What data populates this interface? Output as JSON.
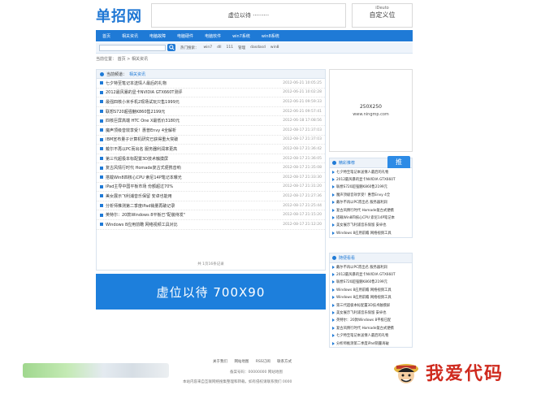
{
  "header": {
    "logo": "单招网",
    "banner_text": "虚位以待 ·········",
    "ad_small": "iDeuto",
    "ad_big": "自定义位"
  },
  "nav": [
    "首页",
    "相关资讯",
    "电脑故障",
    "电脑硬件",
    "电脑软件",
    "win7系统",
    "win8系统"
  ],
  "search": {
    "hot_label": "热门搜索：",
    "hot_words": [
      "win7",
      "dll",
      "111",
      "管理",
      "dasdasd",
      "win8"
    ]
  },
  "breadcrumb": "当前位置： 首页 > 相关资讯",
  "list": {
    "head_title": "当前频道：",
    "head_current": "相关资讯",
    "rows": [
      {
        "title": "七夕特至笔记本送情人最后的礼物",
        "date": "2012-06-21 10:05:25"
      },
      {
        "title": "2012最风暴的显卡NVIDIA GTX660T测评",
        "date": "2012-06-21 10:02:28"
      },
      {
        "title": "最强四核小米手机2现场试玩只售1999元",
        "date": "2012-06-21 09:59:33"
      },
      {
        "title": "联想S720超强魅K860售2199元",
        "date": "2012-06-21 09:57:41"
      },
      {
        "title": "四核巨屏高端 HTC One X最低价3180元",
        "date": "2012-06-18 17:08:56"
      },
      {
        "title": "魔声顶级音效享受！惠普Envy 4全解析",
        "date": "2012-08-17 21:37:03"
      },
      {
        "title": "IBM宣布量子计算机研究已获得重大突破",
        "date": "2012-08-17 21:37:03"
      },
      {
        "title": "戴尔不再以PC而出名 服务器利润率更高",
        "date": "2012-08-17 21:36:42"
      },
      {
        "title": "第三代超极本标配置3D技术触摸屏",
        "date": "2012-08-17 21:36:05"
      },
      {
        "title": "复古风情行时代 Homade复古式便携音响",
        "date": "2012-08-17 21:35:08"
      },
      {
        "title": "搭载Win8四核心CPU 索尼14P笔记本曝光",
        "date": "2012-08-17 21:33:30"
      },
      {
        "title": "iPad主导中国平板市场 份额超过70%",
        "date": "2012-08-17 21:31:20"
      },
      {
        "title": "美女展示飞利浦音乐保留 安卓也能用",
        "date": "2012-08-17 21:27:36"
      },
      {
        "title": "分析师推测第二季度iPad销量再破记录",
        "date": "2012-08-17 21:25:44"
      },
      {
        "title": "英特尔：20款Windows 8平板已\"配装待发\"",
        "date": "2012-08-17 21:15:20"
      },
      {
        "title": "Windows 8应用前瞻 网络视频工具对比",
        "date": "2012-08-17 21:12:20"
      }
    ],
    "pager": "共 1页16条记录"
  },
  "big_ad": "虚位以待 700X90",
  "side_ad": {
    "size": "250X250",
    "url": "www.ningmp.com"
  },
  "recommend": {
    "title": "精彩推荐",
    "tag": "推",
    "items": [
      "七夕特至笔记本送情人最后的礼物",
      "2012最风暴的显卡NVIDIA GTX660T",
      "联想S720超强魅K860售2199元",
      "魔声顶级音效享受！惠普Envy 4全",
      "戴尔不再以PC而出名 服务器利润",
      "复古风情行时代 Homade复古式便携",
      "搭载Win8四核心CPU 索尼14P笔记本",
      "美女展示飞利浦音乐保留 安卓也",
      "Windows 8应用前瞻 网络视频工具"
    ]
  },
  "random": {
    "title": "随便看看",
    "items": [
      "戴尔不再以PC而出名 服务器利润",
      "2012最风暴的显卡NVIDIA GTX660T",
      "联想S720超强魅K860售2199元",
      "Windows 8应用前瞻 网络视频工具",
      "Windows 8应用前瞻 网络视频工具",
      "第三代超极本标配置3D技术触摸屏",
      "美女展示飞利浦音乐保留 安卓也",
      "英特尔：20款Windows 8平板已配",
      "复古风情行时代 Homade复古式便携",
      "七夕特至笔记本送情人最后的礼物",
      "分析师推测第二季度iPad销量再破"
    ]
  },
  "footer": {
    "links": [
      "关于我们",
      "网站地图",
      "RSS订阅",
      "联系方式"
    ],
    "icp": "备案号码：00000000  网站地图",
    "copy": "本站内容来自互联网络搜集整理和转载，如有侵权请联系我们 0000"
  },
  "watermark": "我爱代码"
}
